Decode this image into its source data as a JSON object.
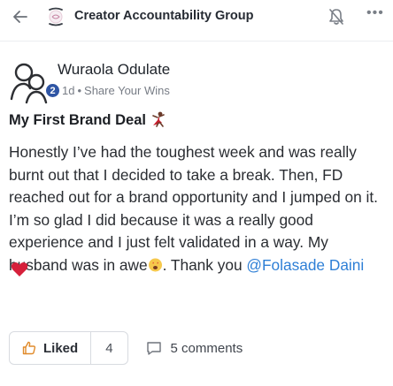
{
  "header": {
    "group_title": "Creator Accountability Group",
    "more_glyph": "•••",
    "back_icon": "arrow-left-icon",
    "bell_icon": "bell-off-icon"
  },
  "post": {
    "author": "Wuraola Odulate",
    "badge": "2",
    "time": "1d",
    "separator": "•",
    "category": "Share Your Wins",
    "title": "My First Brand Deal",
    "body_part1": "Honestly I’ve had the toughest week and was really burnt out that I decided to take a break. Then, FD reached out for a brand opportunity and I jumped on it. I’m so glad I did because it was a really good experience and I just felt validated in a way. My husband was in awe",
    "body_part2": ". Thank you ",
    "mention": "@Folasade Daini"
  },
  "actions": {
    "like_label": "Liked",
    "like_count": "4",
    "comments_label": "5 comments"
  },
  "colors": {
    "accent": "#2e7fd6",
    "heart": "#d6203b",
    "badge": "#2f55a4"
  }
}
